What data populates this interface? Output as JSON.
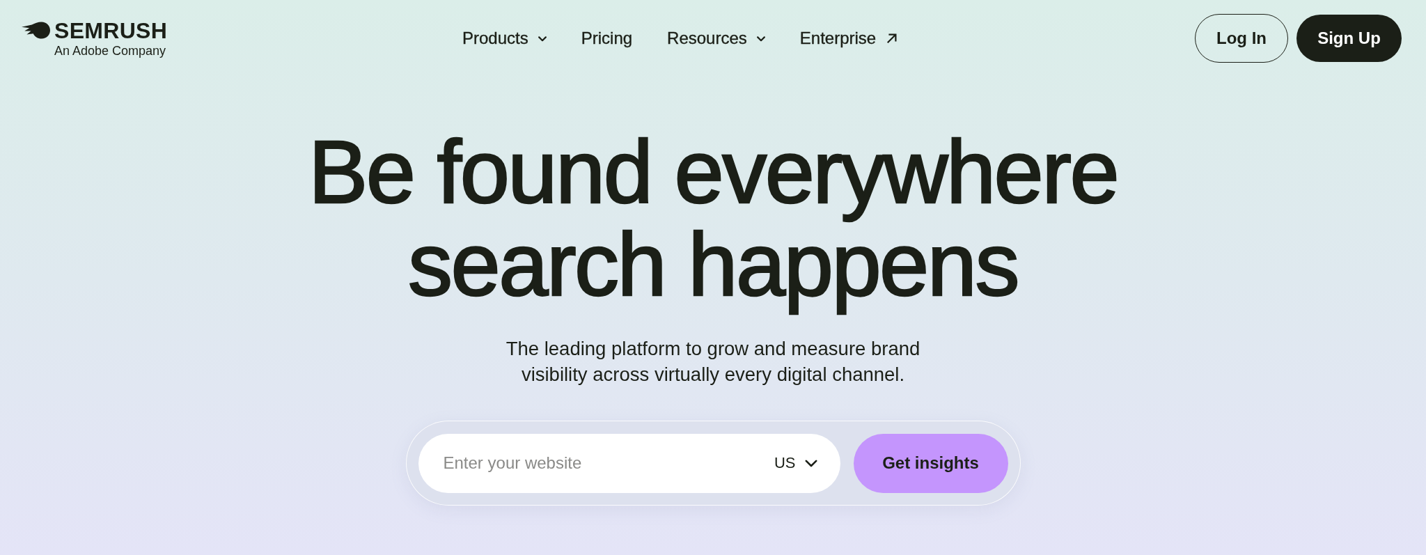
{
  "header": {
    "logo": {
      "wordmark": "SEMRUSH",
      "tagline": "An Adobe Company"
    },
    "nav": [
      {
        "label": "Products",
        "kind": "dropdown"
      },
      {
        "label": "Pricing",
        "kind": "link"
      },
      {
        "label": "Resources",
        "kind": "dropdown"
      },
      {
        "label": "Enterprise",
        "kind": "external"
      }
    ],
    "actions": [
      {
        "label": "Log In",
        "kind": "outline"
      },
      {
        "label": "Sign Up",
        "kind": "filled"
      }
    ]
  },
  "hero": {
    "headline": "Be found everywhere search happens",
    "subtitle": "The leading platform to grow and measure brand visibility across virtually every digital channel."
  },
  "search": {
    "placeholder": "Enter your website",
    "country": "US",
    "button": "Get insights"
  }
}
